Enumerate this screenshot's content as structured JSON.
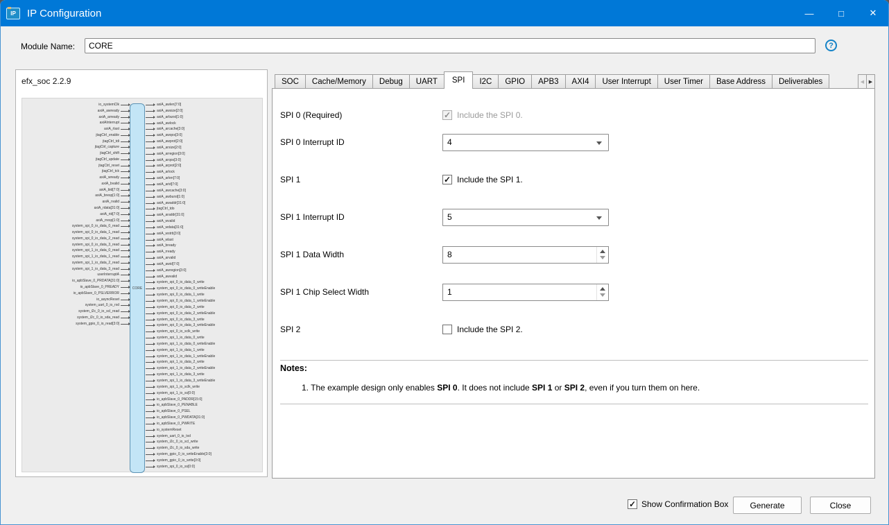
{
  "window": {
    "title": "IP Configuration",
    "icon_text": "IP",
    "minimize": "—",
    "maximize": "□",
    "close": "✕"
  },
  "module": {
    "label": "Module Name:",
    "value": "CORE",
    "help": "?"
  },
  "left_panel": {
    "title": "efx_soc 2.2.9",
    "core_label": "CORE",
    "left_signals": [
      "io_systemClk",
      "axiA_awready",
      "axiA_arready",
      "axiAInterrupt",
      "axiA_rlast",
      "jtagCtrl_enable",
      "jtagCtrl_tdi",
      "jtagCtrl_capture",
      "jtagCtrl_shift",
      "jtagCtrl_update",
      "jtagCtrl_reset",
      "jtagCtrl_tck",
      "axiA_wready",
      "axiA_bvalid",
      "axiA_bid[7:0]",
      "axiA_bresp[1:0]",
      "axiA_rvalid",
      "axiA_rdata[31:0]",
      "axiA_rid[7:0]",
      "axiA_rresp[1:0]",
      "system_spi_0_io_data_0_read",
      "system_spi_0_io_data_1_read",
      "system_spi_0_io_data_2_read",
      "system_spi_0_io_data_3_read",
      "system_spi_1_io_data_0_read",
      "system_spi_1_io_data_1_read",
      "system_spi_1_io_data_2_read",
      "system_spi_1_io_data_3_read",
      "userInterruptA",
      "io_apbSlave_0_PRDATA[31:0]",
      "io_apbSlave_0_PREADY",
      "io_apbSlave_0_PSLVERROR",
      "io_asyncReset",
      "system_uart_0_io_rxd",
      "system_i2c_0_io_scl_read",
      "system_i2c_0_io_sda_read",
      "system_gpio_0_io_read[3:0]"
    ],
    "right_signals": [
      "axiA_awlen[7:0]",
      "axiA_awsize[2:0]",
      "axiA_arburst[1:0]",
      "axiA_awlock",
      "axiA_arcache[3:0]",
      "axiA_awqos[3:0]",
      "axiA_awprot[2:0]",
      "axiA_arsize[2:0]",
      "axiA_arregion[3:0]",
      "axiA_arqos[3:0]",
      "axiA_arprot[2:0]",
      "axiA_arlock",
      "axiA_arlen[7:0]",
      "axiA_arid[7:0]",
      "axiA_awcache[3:0]",
      "axiA_awburst[1:0]",
      "axiA_awaddr[31:0]",
      "jtagCtrl_tdo",
      "axiA_araddr[31:0]",
      "axiA_wvalid",
      "axiA_wdata[31:0]",
      "axiA_wstrb[3:0]",
      "axiA_wlast",
      "axiA_bready",
      "axiA_rready",
      "axiA_arvalid",
      "axiA_awid[7:0]",
      "axiA_awregion[3:0]",
      "axiA_awvalid",
      "system_spi_0_io_data_0_write",
      "system_spi_0_io_data_0_writeEnable",
      "system_spi_0_io_data_1_write",
      "system_spi_0_io_data_1_writeEnable",
      "system_spi_0_io_data_2_write",
      "system_spi_0_io_data_2_writeEnable",
      "system_spi_0_io_data_3_write",
      "system_spi_0_io_data_3_writeEnable",
      "system_spi_0_io_sclk_write",
      "system_spi_1_io_data_0_write",
      "system_spi_1_io_data_0_writeEnable",
      "system_spi_1_io_data_1_write",
      "system_spi_1_io_data_1_writeEnable",
      "system_spi_1_io_data_2_write",
      "system_spi_1_io_data_2_writeEnable",
      "system_spi_1_io_data_3_write",
      "system_spi_1_io_data_3_writeEnable",
      "system_spi_1_io_sclk_write",
      "system_spi_1_io_ss[0:0]",
      "io_apbSlave_0_PADDR[15:0]",
      "io_apbSlave_0_PENABLE",
      "io_apbSlave_0_PSEL",
      "io_apbSlave_0_PWDATA[31:0]",
      "io_apbSlave_0_PWRITE",
      "io_systemReset",
      "system_uart_0_io_txd",
      "system_i2c_0_io_scl_write",
      "system_i2c_0_io_sda_write",
      "system_gpio_0_io_writeEnable[3:0]",
      "system_gpio_0_io_write[3:0]",
      "system_spi_0_io_ss[0:0]"
    ]
  },
  "tabs": [
    {
      "label": "SOC",
      "selected": false
    },
    {
      "label": "Cache/Memory",
      "selected": false
    },
    {
      "label": "Debug",
      "selected": false
    },
    {
      "label": "UART",
      "selected": false
    },
    {
      "label": "SPI",
      "selected": true
    },
    {
      "label": "I2C",
      "selected": false
    },
    {
      "label": "GPIO",
      "selected": false
    },
    {
      "label": "APB3",
      "selected": false
    },
    {
      "label": "AXI4",
      "selected": false
    },
    {
      "label": "User Interrupt",
      "selected": false
    },
    {
      "label": "User Timer",
      "selected": false
    },
    {
      "label": "Base Address",
      "selected": false
    },
    {
      "label": "Deliverables",
      "selected": false
    }
  ],
  "tab_scroll": {
    "left": "◀",
    "right": "▶"
  },
  "form": {
    "spi0": {
      "label": "SPI 0 (Required)",
      "check": "✓",
      "text": "Include the SPI 0."
    },
    "spi0_irq": {
      "label": "SPI 0 Interrupt ID",
      "value": "4"
    },
    "spi1": {
      "label": "SPI 1",
      "check": "✓",
      "text": "Include the SPI 1."
    },
    "spi1_irq": {
      "label": "SPI 1 Interrupt ID",
      "value": "5"
    },
    "spi1_dw": {
      "label": "SPI 1 Data Width",
      "value": "8"
    },
    "spi1_csw": {
      "label": "SPI 1 Chip Select Width",
      "value": "1"
    },
    "spi2": {
      "label": "SPI 2",
      "check": "",
      "text": "Include the SPI 2."
    }
  },
  "notes": {
    "title": "Notes:",
    "item_parts": [
      "1. The example design only enables ",
      "SPI 0",
      ". It does not include ",
      "SPI 1",
      " or ",
      "SPI 2",
      ", even if you turn them on here."
    ]
  },
  "footer": {
    "confirm_check": "✓",
    "confirm_label": "Show Confirmation Box",
    "generate": "Generate",
    "close": "Close"
  }
}
